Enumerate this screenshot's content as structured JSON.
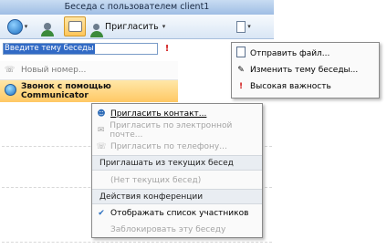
{
  "window": {
    "title": "Беседа с пользователем client1"
  },
  "toolbar": {
    "invite_label": "Пригласить",
    "caret": "▾"
  },
  "topic": {
    "placeholder": "Введите тему беседы",
    "important_glyph": "!"
  },
  "calls": [
    {
      "label": "Новый номер...",
      "icon": "phone-icon"
    },
    {
      "label": "Звонок с помощью Communicator",
      "icon": "communicator-icon"
    }
  ],
  "share_menu": [
    {
      "label": "Отправить файл...",
      "icon": "file-icon",
      "enabled": true
    },
    {
      "label": "Изменить тему беседы...",
      "icon": "chat-topic-icon",
      "enabled": true
    },
    {
      "label": "Высокая важность",
      "icon": "exclamation-icon",
      "enabled": true
    }
  ],
  "invite_menu": {
    "items": [
      {
        "label": "Пригласить контакт...",
        "icon": "add-contact-icon",
        "enabled": true
      },
      {
        "label": "Пригласить по электронной почте...",
        "icon": "email-icon",
        "enabled": false
      },
      {
        "label": "Пригласить по телефону...",
        "icon": "phone-icon",
        "enabled": false
      }
    ],
    "current_header": "Приглашать из текущих бесед",
    "no_current": "(Нет текущих бесед)",
    "conference_header": "Действия конференции",
    "show_participants": "Отображать список участников",
    "lock": "Заблокировать эту беседу"
  }
}
